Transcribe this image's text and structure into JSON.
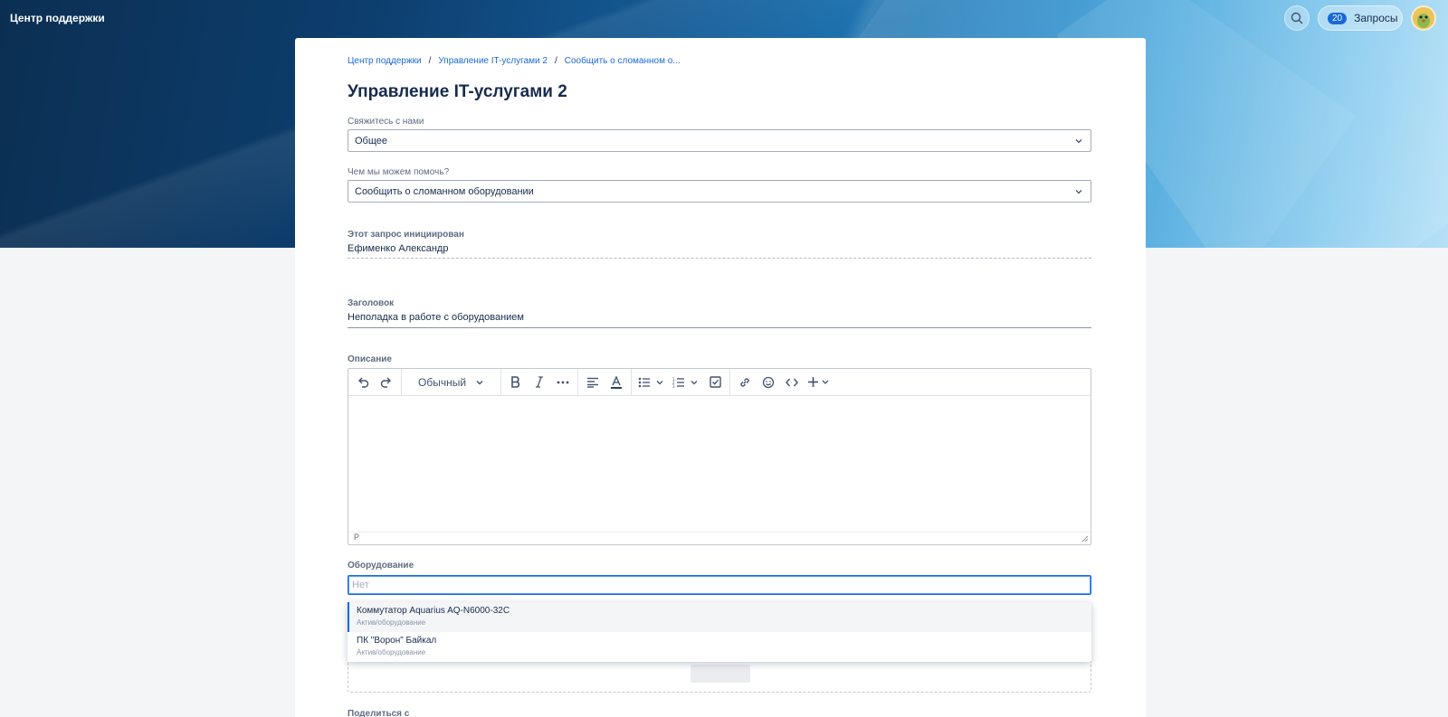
{
  "header": {
    "brand": "Центр поддержки",
    "requests_count": "20",
    "requests_label": "Запросы"
  },
  "breadcrumb": {
    "items": [
      "Центр поддержки",
      "Управление IT-услугами 2",
      "Сообщить о сломанном о..."
    ]
  },
  "page_title": "Управление IT-услугами 2",
  "form": {
    "contact_label": "Свяжитесь с нами",
    "contact_value": "Общее",
    "help_label": "Чем мы можем помочь?",
    "help_value": "Сообщить о сломанном оборудовании",
    "initiated_label": "Этот запрос инициирован",
    "initiated_value": "Ефименко Александр",
    "title_label": "Заголовок",
    "title_value": "Неполадка в работе с оборудованием",
    "description_label": "Описание",
    "editor": {
      "style_select": "Обычный",
      "status_path": "P"
    },
    "equipment_label": "Оборудование",
    "equipment_placeholder": "Нет",
    "equipment_options": [
      {
        "title": "Коммутатор Aquarius AQ-N6000-32C",
        "subtitle": "Актив/оборудование"
      },
      {
        "title": "ПК \"Ворон\" Байкал",
        "subtitle": "Актив/оборудование"
      }
    ],
    "share_label": "Поделиться с"
  },
  "colors": {
    "accent": "#1868db",
    "text": "#172b4d",
    "muted": "#5e6c84"
  }
}
